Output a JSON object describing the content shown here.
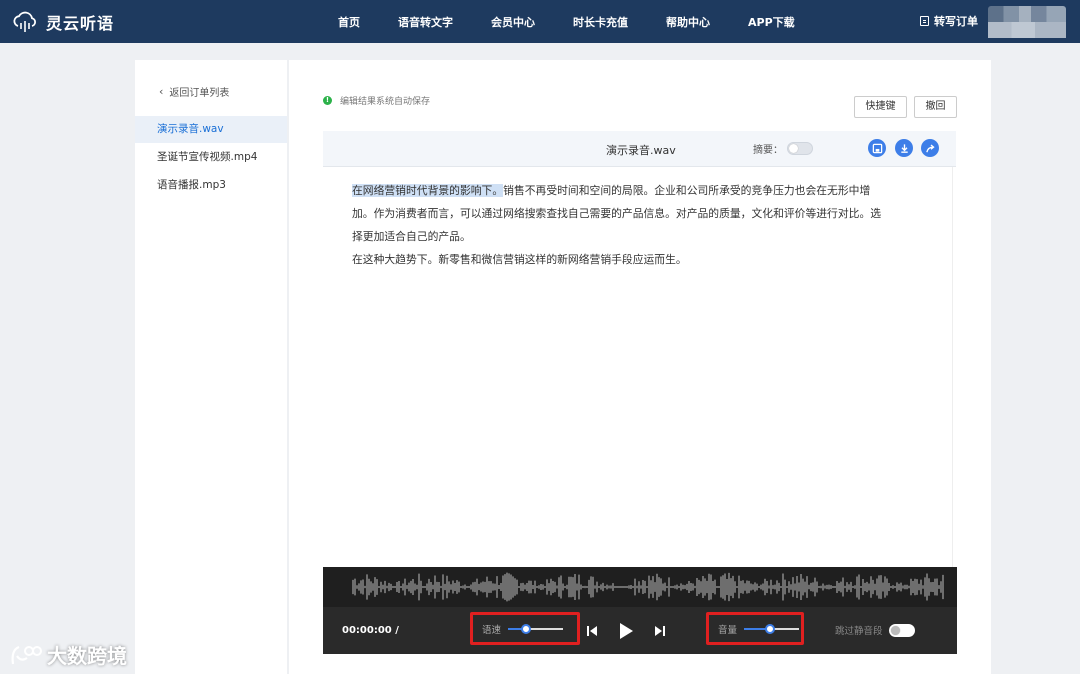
{
  "app": {
    "name": "灵云听语"
  },
  "nav": {
    "items": [
      "首页",
      "语音转文字",
      "会员中心",
      "时长卡充值",
      "帮助中心",
      "APP下载"
    ]
  },
  "header": {
    "order_link": "转写订单"
  },
  "sidebar": {
    "back_label": "返回订单列表",
    "files": [
      "演示录音.wav",
      "圣诞节宣传视频.mp4",
      "语音播报.mp3"
    ],
    "active_index": 0
  },
  "editor": {
    "autosave_note": "编辑结果系统自动保存",
    "shortcut_button": "快捷键",
    "undo_button": "撤回",
    "file_title": "演示录音.wav",
    "summary_label": "摘要：",
    "summary_enabled": false,
    "highlight_text": "在网络营销时代背景的影响下。",
    "para1_rest": "销售不再受时间和空间的局限。企业和公司所承受的竞争压力也会在无形中增",
    "para1_line2": "加。作为消费者而言，可以通过网络搜索查找自己需要的产品信息。对产品的质量，文化和评价等进行对比。选",
    "para1_line3": "择更加适合自己的产品。",
    "para2": "在这种大趋势下。新零售和微信营销这样的新网络营销手段应运而生。"
  },
  "player": {
    "time": "00:00:00 /",
    "speed_label": "语速",
    "speed_level": 0.33,
    "volume_label": "音量",
    "volume_level": 0.47,
    "skip_silence_label": "跳过静音段",
    "skip_silence_enabled": false
  },
  "watermark": {
    "text": "大数跨境"
  },
  "colors": {
    "header_bg": "#1e3a5f",
    "accent": "#3d7ee8",
    "active_file": "#1a6fd6",
    "highlight": "#cfe0f5",
    "annotation_box": "#e02020"
  },
  "icons": [
    "cloud-logo-icon",
    "order-icon",
    "back-chevron-icon",
    "check-dot-icon",
    "save-icon",
    "download-icon",
    "share-icon",
    "prev-icon",
    "play-icon",
    "next-icon"
  ]
}
